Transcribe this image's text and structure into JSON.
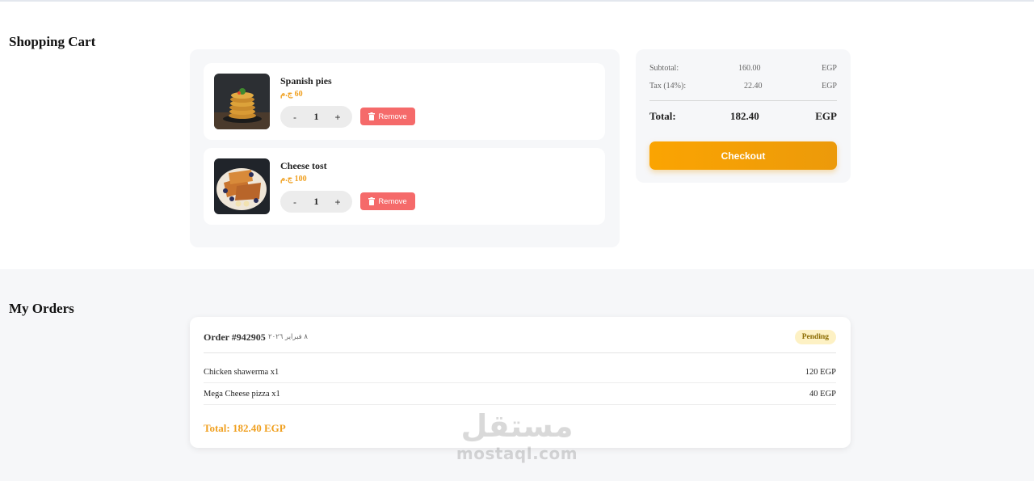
{
  "cart": {
    "title": "Shopping Cart",
    "items": [
      {
        "name": "Spanish pies",
        "price": "60 ج.م",
        "quantity": "1",
        "decrement": "-",
        "increment": "+",
        "remove_label": "Remove",
        "image": "pancake-stack"
      },
      {
        "name": "Cheese tost",
        "price": "100 ج.م",
        "quantity": "1",
        "decrement": "-",
        "increment": "+",
        "remove_label": "Remove",
        "image": "french-toast"
      }
    ]
  },
  "summary": {
    "subtotal_label": "Subtotal:",
    "subtotal_value": "160.00",
    "subtotal_currency": "EGP",
    "tax_label": "Tax (14%):",
    "tax_value": "22.40",
    "tax_currency": "EGP",
    "total_label": "Total:",
    "total_value": "182.40",
    "total_currency": "EGP",
    "checkout_label": "Checkout"
  },
  "orders": {
    "title": "My Orders",
    "list": [
      {
        "id": "Order #942905",
        "date": "٨ فبراير ٢٠٢٦",
        "status": "Pending",
        "lines": [
          {
            "name": "Chicken shawerma x1",
            "price": "120 EGP"
          },
          {
            "name": "Mega Cheese pizza x1",
            "price": "40 EGP"
          }
        ],
        "total": "Total: 182.40 EGP"
      }
    ]
  },
  "watermark": {
    "arabic": "مستقل",
    "latin": "mostaql.com"
  },
  "colors": {
    "accent": "#f0a020",
    "checkout": "#fba402",
    "remove": "#f56a6a",
    "pending_bg": "#fdf1c4",
    "panel_bg": "#f6f7f9"
  },
  "icons": {
    "remove": "trash-icon"
  }
}
